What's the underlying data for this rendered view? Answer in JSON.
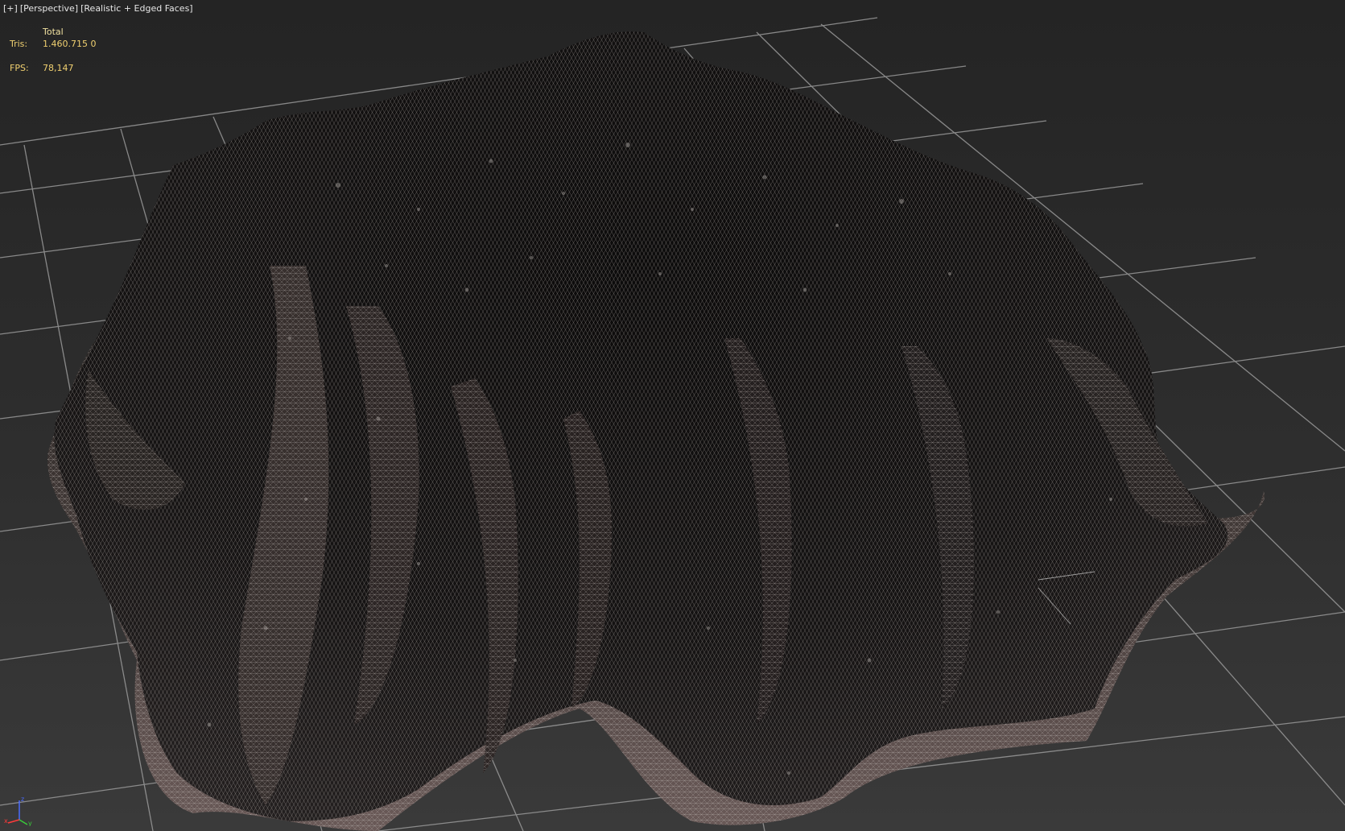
{
  "viewport": {
    "label_plus": "[+]",
    "label_view": "[Perspective]",
    "label_shading": "[Realistic + Edged Faces]"
  },
  "stats": {
    "header": "Total",
    "tris_label": "Tris:",
    "tris_value": "1.460.715 0",
    "fps_label": "FPS:",
    "fps_value": "78,147"
  },
  "axis": {
    "x": "x",
    "y": "y",
    "z": "z"
  },
  "colors": {
    "background": "#2b2b2b",
    "grid": "#9a9a9a",
    "label_text": "#e6e6e6",
    "stats_text": "#f0d070",
    "mesh_dark": "#161414",
    "mesh_wire": "#c8c0bc"
  }
}
